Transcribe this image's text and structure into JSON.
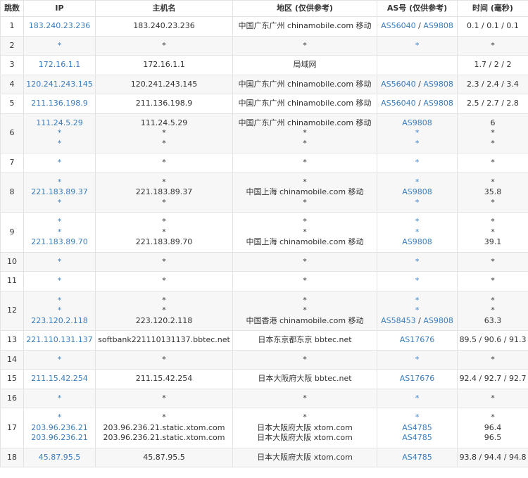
{
  "table": {
    "headers": [
      "跳数",
      "IP",
      "主机名",
      "地区 (仅供参考)",
      "AS号 (仅供参考)",
      "时间 (毫秒)"
    ],
    "rows": [
      {
        "hop": "1",
        "ip": [
          "183.240.23.236"
        ],
        "host": [
          "183.240.23.236"
        ],
        "region": [
          "中国广东广州 chinamobile.com 移动"
        ],
        "as": [
          [
            "AS56040",
            "AS9808"
          ]
        ],
        "time": [
          "0.1 / 0.1 / 0.1"
        ]
      },
      {
        "hop": "2",
        "ip": [
          "*"
        ],
        "host": [
          "*"
        ],
        "region": [
          "*"
        ],
        "as": [
          [
            "*"
          ]
        ],
        "time": [
          "*"
        ]
      },
      {
        "hop": "3",
        "ip": [
          "172.16.1.1"
        ],
        "host": [
          "172.16.1.1"
        ],
        "region": [
          "局域网"
        ],
        "as": [
          []
        ],
        "time": [
          "1.7 / 2 / 2"
        ]
      },
      {
        "hop": "4",
        "ip": [
          "120.241.243.145"
        ],
        "host": [
          "120.241.243.145"
        ],
        "region": [
          "中国广东广州 chinamobile.com 移动"
        ],
        "as": [
          [
            "AS56040",
            "AS9808"
          ]
        ],
        "time": [
          "2.3 / 2.4 / 3.4"
        ]
      },
      {
        "hop": "5",
        "ip": [
          "211.136.198.9"
        ],
        "host": [
          "211.136.198.9"
        ],
        "region": [
          "中国广东广州 chinamobile.com 移动"
        ],
        "as": [
          [
            "AS56040",
            "AS9808"
          ]
        ],
        "time": [
          "2.5 / 2.7 / 2.8"
        ]
      },
      {
        "hop": "6",
        "ip": [
          "111.24.5.29",
          "*",
          "*"
        ],
        "host": [
          "111.24.5.29",
          "*",
          "*"
        ],
        "region": [
          "中国广东广州 chinamobile.com 移动",
          "*",
          "*"
        ],
        "as": [
          [
            "AS9808"
          ],
          [
            "*"
          ],
          [
            "*"
          ]
        ],
        "time": [
          "6",
          "*",
          "*"
        ]
      },
      {
        "hop": "7",
        "ip": [
          "*"
        ],
        "host": [
          "*"
        ],
        "region": [
          "*"
        ],
        "as": [
          [
            "*"
          ]
        ],
        "time": [
          "*"
        ]
      },
      {
        "hop": "8",
        "ip": [
          "*",
          "221.183.89.37",
          "*"
        ],
        "host": [
          "*",
          "221.183.89.37",
          "*"
        ],
        "region": [
          "*",
          "中国上海 chinamobile.com 移动",
          "*"
        ],
        "as": [
          [
            "*"
          ],
          [
            "AS9808"
          ],
          [
            "*"
          ]
        ],
        "time": [
          "*",
          "35.8",
          "*"
        ]
      },
      {
        "hop": "9",
        "ip": [
          "*",
          "*",
          "221.183.89.70"
        ],
        "host": [
          "*",
          "*",
          "221.183.89.70"
        ],
        "region": [
          "*",
          "*",
          "中国上海 chinamobile.com 移动"
        ],
        "as": [
          [
            "*"
          ],
          [
            "*"
          ],
          [
            "AS9808"
          ]
        ],
        "time": [
          "*",
          "*",
          "39.1"
        ]
      },
      {
        "hop": "10",
        "ip": [
          "*"
        ],
        "host": [
          "*"
        ],
        "region": [
          "*"
        ],
        "as": [
          [
            "*"
          ]
        ],
        "time": [
          "*"
        ]
      },
      {
        "hop": "11",
        "ip": [
          "*"
        ],
        "host": [
          "*"
        ],
        "region": [
          "*"
        ],
        "as": [
          [
            "*"
          ]
        ],
        "time": [
          "*"
        ]
      },
      {
        "hop": "12",
        "ip": [
          "*",
          "*",
          "223.120.2.118"
        ],
        "host": [
          "*",
          "*",
          "223.120.2.118"
        ],
        "region": [
          "*",
          "*",
          "中国香港 chinamobile.com 移动"
        ],
        "as": [
          [
            "*"
          ],
          [
            "*"
          ],
          [
            "AS58453",
            "AS9808"
          ]
        ],
        "time": [
          "*",
          "*",
          "63.3"
        ]
      },
      {
        "hop": "13",
        "ip": [
          "221.110.131.137"
        ],
        "host": [
          "softbank221110131137.bbtec.net"
        ],
        "region": [
          "日本东京都东京 bbtec.net"
        ],
        "as": [
          [
            "AS17676"
          ]
        ],
        "time": [
          "89.5 / 90.6 / 91.3"
        ]
      },
      {
        "hop": "14",
        "ip": [
          "*"
        ],
        "host": [
          "*"
        ],
        "region": [
          "*"
        ],
        "as": [
          [
            "*"
          ]
        ],
        "time": [
          "*"
        ]
      },
      {
        "hop": "15",
        "ip": [
          "211.15.42.254"
        ],
        "host": [
          "211.15.42.254"
        ],
        "region": [
          "日本大阪府大阪 bbtec.net"
        ],
        "as": [
          [
            "AS17676"
          ]
        ],
        "time": [
          "92.4 / 92.7 / 92.7"
        ]
      },
      {
        "hop": "16",
        "ip": [
          "*"
        ],
        "host": [
          "*"
        ],
        "region": [
          "*"
        ],
        "as": [
          [
            "*"
          ]
        ],
        "time": [
          "*"
        ]
      },
      {
        "hop": "17",
        "ip": [
          "*",
          "203.96.236.21",
          "203.96.236.21"
        ],
        "host": [
          "*",
          "203.96.236.21.static.xtom.com",
          "203.96.236.21.static.xtom.com"
        ],
        "region": [
          "*",
          "日本大阪府大阪 xtom.com",
          "日本大阪府大阪 xtom.com"
        ],
        "as": [
          [
            "*"
          ],
          [
            "AS4785"
          ],
          [
            "AS4785"
          ]
        ],
        "time": [
          "*",
          "96.4",
          "96.5"
        ]
      },
      {
        "hop": "18",
        "ip": [
          "45.87.95.5"
        ],
        "host": [
          "45.87.95.5"
        ],
        "region": [
          "日本大阪府大阪 xtom.com"
        ],
        "as": [
          [
            "AS4785"
          ]
        ],
        "time": [
          "93.8 / 94.4 / 94.8"
        ]
      }
    ]
  }
}
